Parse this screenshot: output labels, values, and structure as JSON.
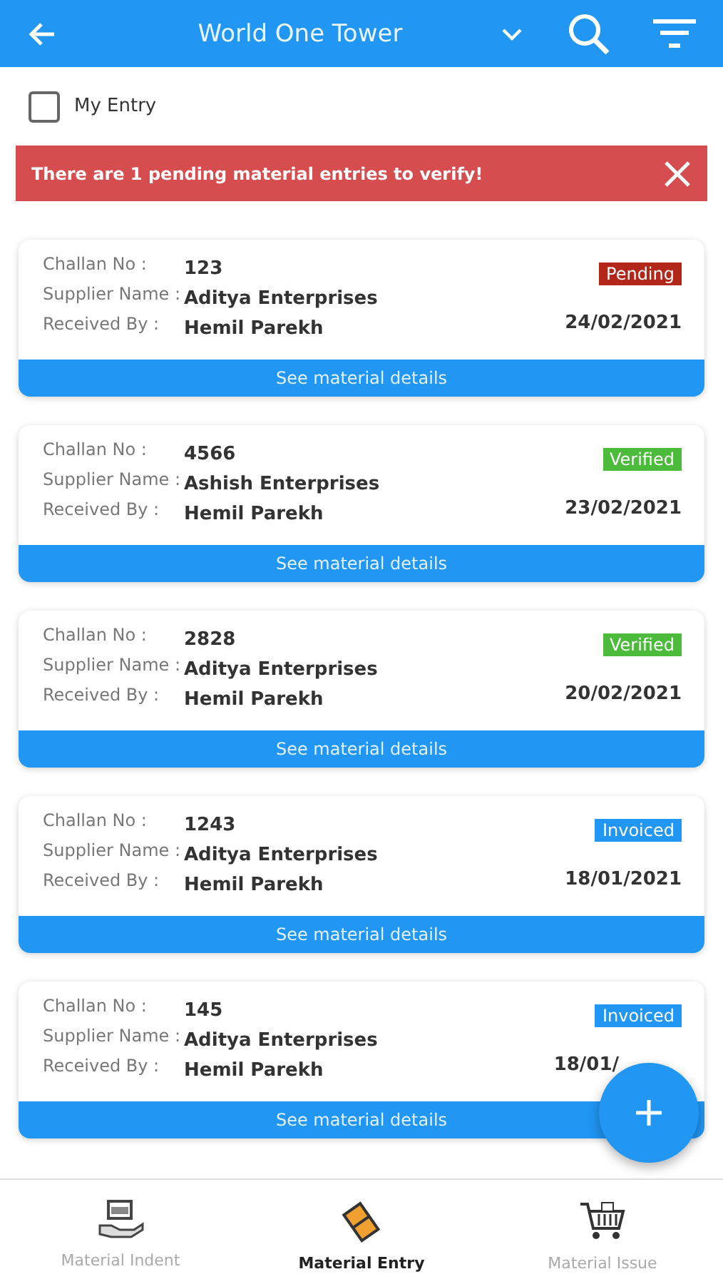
{
  "header": {
    "title": "World One Tower"
  },
  "my_entry": {
    "label": "My Entry",
    "checked": false
  },
  "alert": {
    "message": "There are 1 pending material entries to verify!"
  },
  "entries": [
    {
      "challan_label": "Challan No :",
      "challan": "123",
      "supplier_label": "Supplier Name :",
      "supplier": "Aditya Enterprises",
      "received_label": "Received By :",
      "received": "Hemil Parekh",
      "status": "Pending",
      "color": "#b3261a",
      "date": "24/02/2021",
      "details": "See material details"
    },
    {
      "challan_label": "Challan No :",
      "challan": "4566",
      "supplier_label": "Supplier Name :",
      "supplier": "Ashish Enterprises",
      "received_label": "Received By :",
      "received": "Hemil Parekh",
      "status": "Verified",
      "color": "#4cba3b",
      "date": "23/02/2021",
      "details": "See material details"
    },
    {
      "challan_label": "Challan No :",
      "challan": "2828",
      "supplier_label": "Supplier Name :",
      "supplier": "Aditya Enterprises",
      "received_label": "Received By :",
      "received": "Hemil Parekh",
      "status": "Verified",
      "color": "#4cba3b",
      "date": "20/02/2021",
      "details": "See material details"
    },
    {
      "challan_label": "Challan No :",
      "challan": "1243",
      "supplier_label": "Supplier Name :",
      "supplier": "Aditya Enterprises",
      "received_label": "Received By :",
      "received": "Hemil Parekh",
      "status": "Invoiced",
      "color": "#2196f3",
      "date": "18/01/2021",
      "details": "See material details"
    },
    {
      "challan_label": "Challan No :",
      "challan": "145",
      "supplier_label": "Supplier Name :",
      "supplier": "Aditya Enterprises",
      "received_label": "Received By :",
      "received": "Hemil Parekh",
      "status": "Invoiced",
      "color": "#2196f3",
      "date": "18/01/",
      "date_cut": true,
      "details": "See material details"
    }
  ],
  "nav": [
    {
      "kind": "indent",
      "label": "Material Indent",
      "selected": false
    },
    {
      "kind": "entry",
      "label": "Material Entry",
      "selected": true
    },
    {
      "kind": "issue",
      "label": "Material Issue",
      "selected": false
    }
  ]
}
